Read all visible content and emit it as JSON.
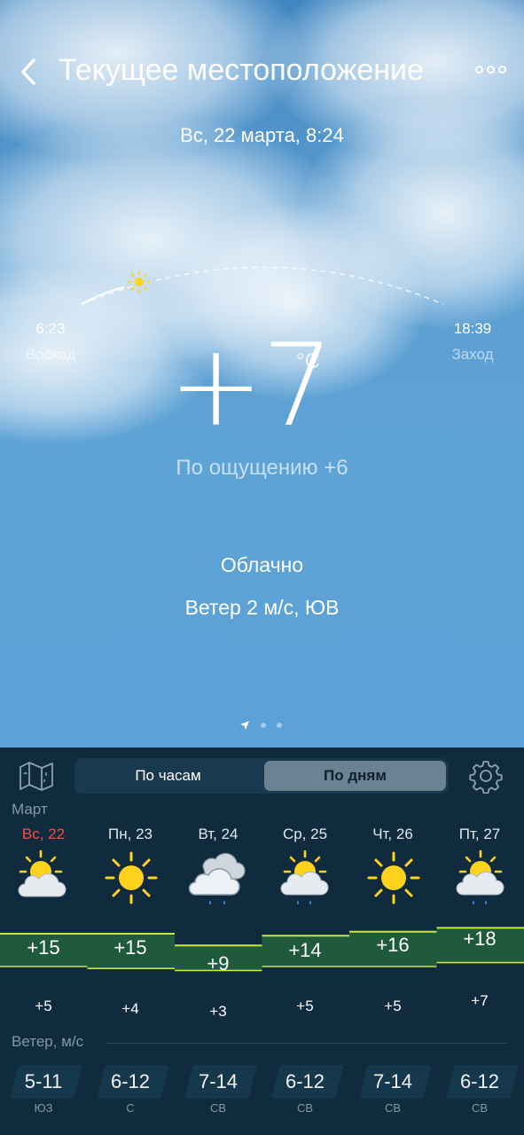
{
  "header": {
    "title": "Текущее местоположение",
    "date": "Вс, 22 марта, 8:24"
  },
  "sun": {
    "sunrise_time": "6:23",
    "sunrise_label": "Восход",
    "sunset_time": "18:39",
    "sunset_label": "Заход"
  },
  "current": {
    "temperature": "+7",
    "unit": "°C",
    "feels_like": "По ощущению +6",
    "condition": "Облачно",
    "wind": "Ветер 2 м/с, ЮВ"
  },
  "tabs": {
    "hourly": "По часам",
    "daily": "По дням",
    "selected": "daily"
  },
  "forecast": {
    "month": "Март",
    "days": [
      {
        "name": "Вс, 22",
        "icon": "partly-cloudy-icon",
        "max": "+15",
        "min": "+5"
      },
      {
        "name": "Пн, 23",
        "icon": "sunny-icon",
        "max": "+15",
        "min": "+4"
      },
      {
        "name": "Вт, 24",
        "icon": "cloudy-rain-icon",
        "max": "+9",
        "min": "+3"
      },
      {
        "name": "Ср, 25",
        "icon": "partly-cloudy-rain-icon",
        "max": "+14",
        "min": "+5"
      },
      {
        "name": "Чт, 26",
        "icon": "sunny-icon",
        "max": "+16",
        "min": "+5"
      },
      {
        "name": "Пт, 27",
        "icon": "partly-cloudy-rain-icon",
        "max": "+18",
        "min": "+7"
      }
    ],
    "max_values": [
      15,
      15,
      9,
      14,
      16,
      18
    ],
    "min_values": [
      5,
      4,
      3,
      5,
      5,
      7
    ]
  },
  "wind_forecast": {
    "label": "Ветер, м/с",
    "items": [
      {
        "speed": "5-11",
        "dir": "ЮЗ"
      },
      {
        "speed": "6-12",
        "dir": "С"
      },
      {
        "speed": "7-14",
        "dir": "СВ"
      },
      {
        "speed": "6-12",
        "dir": "СВ"
      },
      {
        "speed": "7-14",
        "dir": "СВ"
      },
      {
        "speed": "6-12",
        "dir": "СВ"
      }
    ]
  },
  "colors": {
    "today": "#ff4b43",
    "sun": "#ffd21e",
    "temp_band": "#1f5a3c",
    "temp_line": "#c8e63c",
    "panel": "#0f2b3d"
  }
}
